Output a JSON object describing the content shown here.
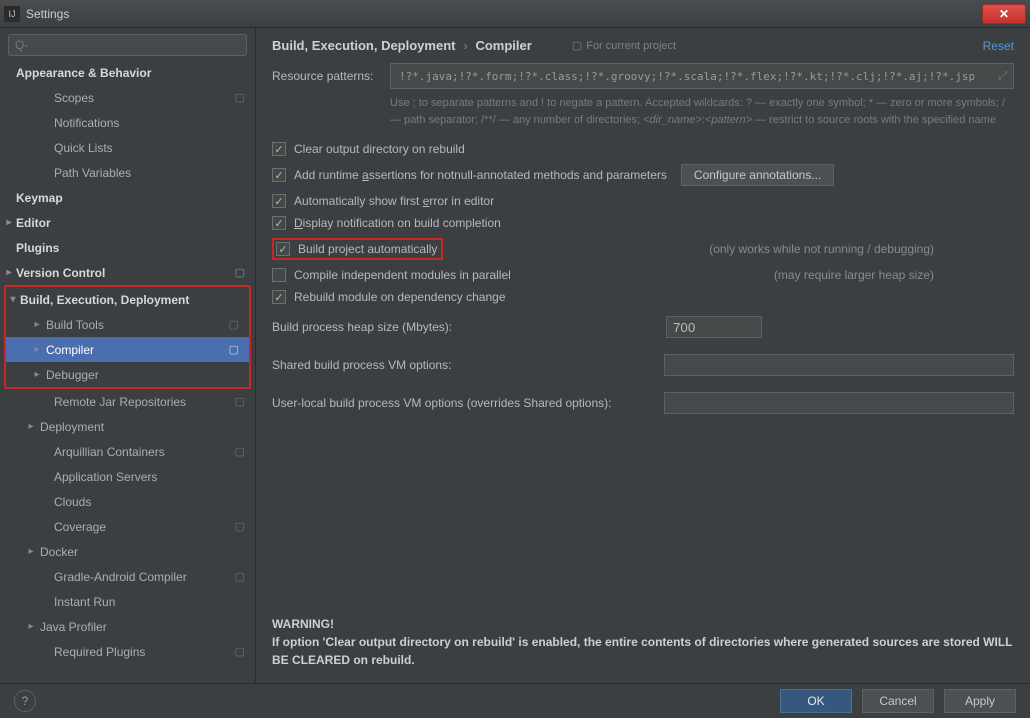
{
  "window": {
    "title": "Settings"
  },
  "search": {
    "placeholder": "Q-"
  },
  "sidebar": {
    "items": [
      {
        "label": "Appearance & Behavior"
      },
      {
        "label": "Scopes"
      },
      {
        "label": "Notifications"
      },
      {
        "label": "Quick Lists"
      },
      {
        "label": "Path Variables"
      },
      {
        "label": "Keymap"
      },
      {
        "label": "Editor"
      },
      {
        "label": "Plugins"
      },
      {
        "label": "Version Control"
      },
      {
        "label": "Build, Execution, Deployment"
      },
      {
        "label": "Build Tools"
      },
      {
        "label": "Compiler"
      },
      {
        "label": "Debugger"
      },
      {
        "label": "Remote Jar Repositories"
      },
      {
        "label": "Deployment"
      },
      {
        "label": "Arquillian Containers"
      },
      {
        "label": "Application Servers"
      },
      {
        "label": "Clouds"
      },
      {
        "label": "Coverage"
      },
      {
        "label": "Docker"
      },
      {
        "label": "Gradle-Android Compiler"
      },
      {
        "label": "Instant Run"
      },
      {
        "label": "Java Profiler"
      },
      {
        "label": "Required Plugins"
      }
    ]
  },
  "breadcrumb": {
    "a": "Build, Execution, Deployment",
    "b": "Compiler",
    "forproj": "For current project",
    "reset": "Reset"
  },
  "form": {
    "resource_label": "Resource patterns:",
    "resource_value": "!?*.java;!?*.form;!?*.class;!?*.groovy;!?*.scala;!?*.flex;!?*.kt;!?*.clj;!?*.aj;!?*.jsp",
    "hint": "Use ; to separate patterns and ! to negate a pattern. Accepted wildcards: ? — exactly one symbol; * — zero or more symbols; / — path separator; /**/ — any number of directories; <dir_name>:<pattern> — restrict to source roots with the specified name",
    "chk_clear": "Clear output directory on rebuild",
    "chk_assert": "Add runtime assertions for notnull-annotated methods and parameters",
    "btn_conf": "Configure annotations...",
    "chk_err": "Automatically show first error in editor",
    "chk_notif": "Display notification on build completion",
    "chk_auto": "Build project automatically",
    "auto_note": "(only works while not running / debugging)",
    "chk_parallel": "Compile independent modules in parallel",
    "parallel_note": "(may require larger heap size)",
    "chk_rebuild": "Rebuild module on dependency change",
    "heap_label": "Build process heap size (Mbytes):",
    "heap_value": "700",
    "shared_label": "Shared build process VM options:",
    "shared_value": "",
    "user_label": "User-local build process VM options (overrides Shared options):",
    "user_value": "",
    "warn_title": "WARNING!",
    "warn_body": "If option 'Clear output directory on rebuild' is enabled, the entire contents of directories where generated sources are stored WILL BE CLEARED on rebuild."
  },
  "footer": {
    "ok": "OK",
    "cancel": "Cancel",
    "apply": "Apply",
    "help": "?"
  }
}
